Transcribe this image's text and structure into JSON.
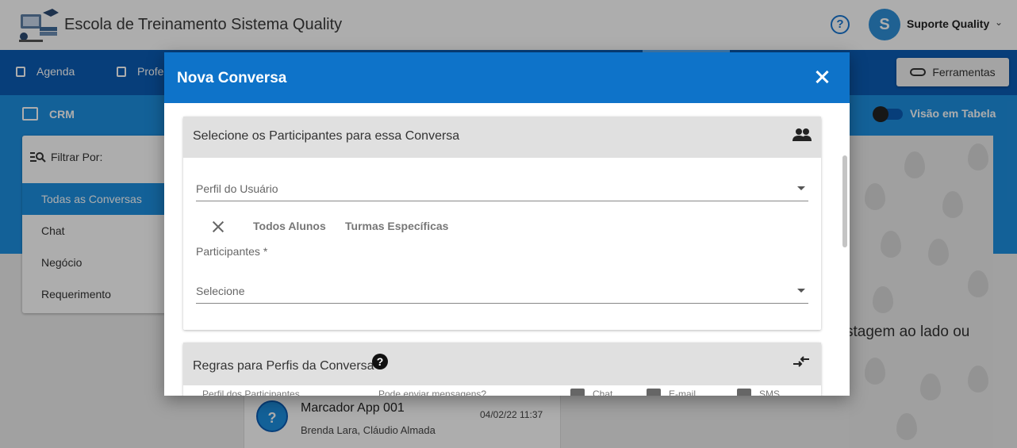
{
  "app": {
    "title": "Escola de Treinamento Sistema Quality",
    "user_initial": "S",
    "user_name": "Suporte Quality",
    "help_symbol": "?"
  },
  "nav": {
    "items": [
      "Agenda",
      "Profe"
    ],
    "tools_label": "Ferramentas"
  },
  "crm": {
    "label": "CRM",
    "toggle_label": "Visão em Tabela"
  },
  "filter": {
    "header": "Filtrar Por:",
    "items": [
      "Todas as Conversas",
      "Chat",
      "Negócio",
      "Requerimento"
    ],
    "active_index": 0
  },
  "empty_state_text": "stagem ao lado ou",
  "conversation": {
    "avatar": "?",
    "title": "Marcador App 001",
    "date": "04/02/22 11:37",
    "participants": "Brenda Lara, Cláudio Almada"
  },
  "modal": {
    "title": "Nova Conversa",
    "participants_section": {
      "title": "Selecione os Participantes para essa Conversa",
      "profile_placeholder": "Perfil do Usuário",
      "tabs": [
        "Todos Alunos",
        "Turmas Específicas"
      ],
      "participants_label": "Participantes *",
      "participants_placeholder": "Selecione"
    },
    "rules_section": {
      "title": "Regras para Perfis da Conversa",
      "help_symbol": "?",
      "columns": [
        "Perfil dos Participantes",
        "Pode enviar mensagens?",
        "Chat",
        "E-mail",
        "SMS"
      ]
    }
  },
  "colors": {
    "header_blue": "#0e73c9",
    "nav_blue": "#0b5cb4",
    "accent_blue": "#1d8fe0"
  }
}
